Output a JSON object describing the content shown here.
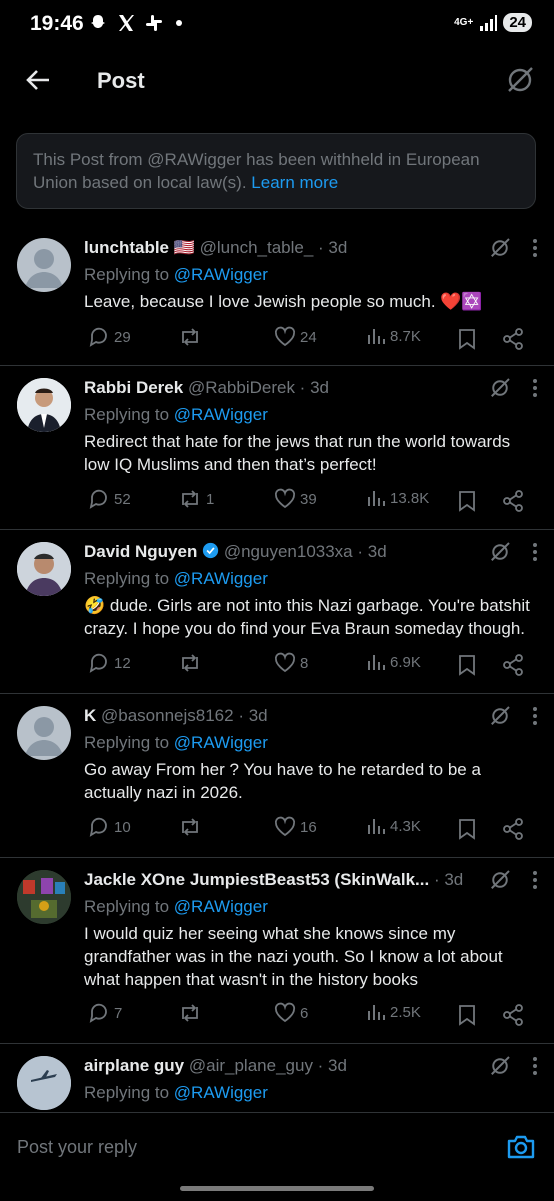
{
  "status": {
    "time": "19:46",
    "network": "4G+",
    "battery": "24"
  },
  "header": {
    "title": "Post",
    "back_icon": "arrow-left-icon",
    "grok_icon": "grok-icon"
  },
  "notice": {
    "text": "This Post from @RAWigger has been withheld in European Union based on local law(s).",
    "link": "Learn more"
  },
  "replies": [
    {
      "name": "lunchtable 🇺🇸",
      "handle": "@lunch_table_ · 3d",
      "replying_label": "Replying to ",
      "replying_to": "@RAWigger",
      "text": "Leave, because I love Jewish people so much. ❤️✡️",
      "replies": "29",
      "reposts": "",
      "likes": "24",
      "views": "8.7K"
    },
    {
      "name": "Rabbi Derek",
      "handle": "@RabbiDerek · 3d",
      "replying_label": "Replying to ",
      "replying_to": "@RAWigger",
      "text": "Redirect that hate for the jews that run the world towards low IQ Muslims and then that’s perfect!",
      "replies": "52",
      "reposts": "1",
      "likes": "39",
      "views": "13.8K"
    },
    {
      "name": "David Nguyen",
      "handle": "@nguyen1033xa · 3d",
      "replying_label": "Replying to ",
      "replying_to": "@RAWigger",
      "text": "🤣 dude. Girls are not into this Nazi garbage. You're batshit crazy. I hope you do find your Eva Braun someday though.",
      "replies": "12",
      "reposts": "",
      "likes": "8",
      "views": "6.9K"
    },
    {
      "name": "K",
      "handle": "@basonnejs8162 · 3d",
      "replying_label": "Replying to ",
      "replying_to": "@RAWigger",
      "text": "Go away From her ? You have to he retarded to be a actually nazi in 2026.",
      "replies": "10",
      "reposts": "",
      "likes": "16",
      "views": "4.3K"
    },
    {
      "name": "Jackle XOne JumpiestBeast53 (SkinWalk...",
      "handle": "· 3d",
      "replying_label": "Replying to ",
      "replying_to": "@RAWigger",
      "text": "I would quiz her seeing what she knows since my grandfather was in the nazi youth. So I know a lot about what happen that wasn't in the history books",
      "replies": "7",
      "reposts": "",
      "likes": "6",
      "views": "2.5K"
    },
    {
      "name": "airplane guy",
      "handle": "@air_plane_guy · 3d",
      "replying_label": "Replying to ",
      "replying_to": "@RAWigger",
      "text": "",
      "replies": "",
      "reposts": "",
      "likes": "",
      "views": ""
    }
  ],
  "composer": {
    "placeholder": "Post your reply",
    "camera_icon": "camera-icon"
  }
}
